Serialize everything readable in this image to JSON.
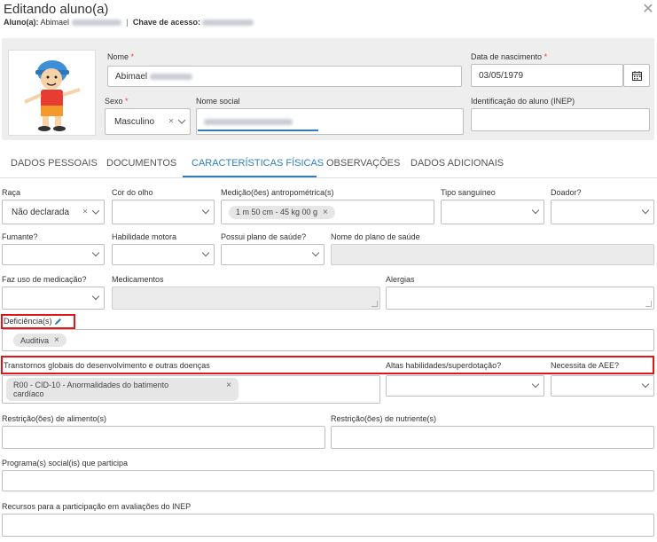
{
  "header": {
    "title": "Editando aluno(a)",
    "student_label": "Aluno(a):",
    "student_name": "Abimael",
    "separator": "|",
    "access_key_label": "Chave de acesso:"
  },
  "top_panel": {
    "nome": {
      "label": "Nome",
      "value": "Abimael"
    },
    "data_nascimento": {
      "label": "Data de nascimento",
      "value": "03/05/1979"
    },
    "sexo": {
      "label": "Sexo",
      "value": "Masculino"
    },
    "nome_social": {
      "label": "Nome social"
    },
    "inep": {
      "label": "Identificação do aluno (INEP)",
      "value": ""
    }
  },
  "tabs": [
    {
      "label": "DADOS PESSOAIS"
    },
    {
      "label": "DOCUMENTOS"
    },
    {
      "label": "CARACTERÍSTICAS FÍSICAS"
    },
    {
      "label": "OBSERVAÇÕES"
    },
    {
      "label": "DADOS ADICIONAIS"
    }
  ],
  "fields": {
    "raca": {
      "label": "Raça",
      "value": "Não declarada"
    },
    "cor_olho": {
      "label": "Cor do olho",
      "value": ""
    },
    "medicao": {
      "label": "Medição(ões) antropométrica(s)",
      "tag": "1 m 50 cm - 45 kg 00 g"
    },
    "tipo_sanguineo": {
      "label": "Tipo sanguíneo",
      "value": ""
    },
    "doador": {
      "label": "Doador?",
      "value": ""
    },
    "fumante": {
      "label": "Fumante?",
      "value": ""
    },
    "habilidade_motora": {
      "label": "Habilidade motora",
      "value": ""
    },
    "plano_saude": {
      "label": "Possui plano de saúde?",
      "value": ""
    },
    "nome_plano": {
      "label": "Nome do plano de saúde",
      "value": ""
    },
    "medicacao": {
      "label": "Faz uso de medicação?",
      "value": ""
    },
    "medicamentos": {
      "label": "Medicamentos",
      "value": ""
    },
    "alergias": {
      "label": "Alergias",
      "value": ""
    },
    "deficiencias": {
      "label": "Deficiência(s)",
      "tag": "Auditiva"
    },
    "transtornos": {
      "label": "Transtornos globais do desenvolvimento e outras doenças",
      "tag_line1": "R00 - CID-10 - Anormalidades do batimento",
      "tag_line2": "cardíaco"
    },
    "altas_habilidades": {
      "label": "Altas habilidades/superdotação?",
      "value": ""
    },
    "aee": {
      "label": "Necessita de AEE?",
      "value": ""
    },
    "restricao_alimento": {
      "label": "Restrição(ões) de alimento(s)",
      "value": ""
    },
    "restricao_nutriente": {
      "label": "Restrição(ões) de nutriente(s)",
      "value": ""
    },
    "programas_sociais": {
      "label": "Programa(s) social(is) que participa",
      "value": ""
    },
    "recursos_inep": {
      "label": "Recursos para a participação em avaliações do INEP",
      "value": ""
    }
  },
  "colors": {
    "accent": "#2e7dbf",
    "highlight": "#e0151c",
    "required": "#e0473d"
  },
  "icons": [
    "close-icon",
    "calendar-icon",
    "pencil-icon",
    "chevron-down-icon",
    "clear-icon"
  ]
}
